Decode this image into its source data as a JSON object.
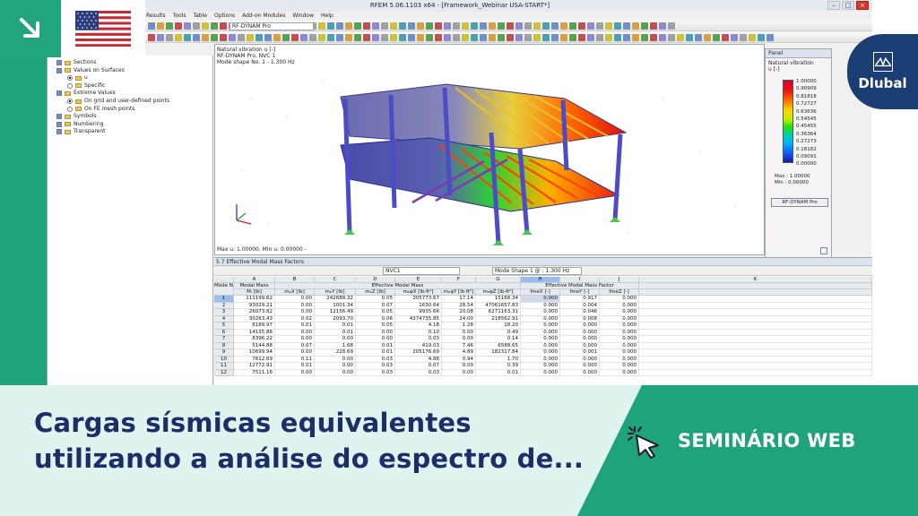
{
  "app": {
    "title": "RFEM 5.06.1103 x64 - [Framework_Webinar USA-START*]",
    "menu": [
      "Results",
      "Tools",
      "Table",
      "Options",
      "Add-on Modules",
      "Window",
      "Help"
    ],
    "module_combo": "RF-DYNAM Pro"
  },
  "navigator": {
    "items": [
      {
        "label": "Sections",
        "control": "check"
      },
      {
        "label": "Values on Surfaces",
        "control": "check"
      },
      {
        "label": "u",
        "control": "radio-on"
      },
      {
        "label": "Specific",
        "control": "radio"
      },
      {
        "label": "Extreme Values",
        "control": "check"
      },
      {
        "label": "On grid and user-defined points",
        "control": "radio-on"
      },
      {
        "label": "On FE mesh points",
        "control": "radio"
      },
      {
        "label": "Symbols",
        "control": "check"
      },
      {
        "label": "Numbering",
        "control": "check"
      },
      {
        "label": "Transparent",
        "control": "check"
      }
    ]
  },
  "viewport": {
    "info_line1": "Natural vibration u [-]",
    "info_line2": "RF-DYNAM Pro, NVC 1",
    "info_line3": "Mode shape No. 1 - 1.300 Hz",
    "status": "Max u: 1.00000, Min u: 0.00000 -"
  },
  "panel": {
    "title": "Panel",
    "subtitle": "Natural vibration",
    "unit": "u [-]",
    "scale": [
      "1.00000",
      "0.90909",
      "0.81818",
      "0.72727",
      "0.63636",
      "0.54545",
      "0.45455",
      "0.36364",
      "0.27273",
      "0.18182",
      "0.09091",
      "0.00000"
    ],
    "max_label": "Max : 1.00000",
    "min_label": "Min : 0.00000",
    "button": "RF-DYNAM Pro"
  },
  "table": {
    "title": "5.7 Effective Modal Mass Factors",
    "combo_nvc": "NVC1",
    "combo_mode": "Mode Shape 1 @ : 1.300 Hz",
    "col_letters": [
      "A",
      "B",
      "C",
      "D",
      "E",
      "F",
      "G",
      "H",
      "I",
      "J",
      "K"
    ],
    "group_headers": {
      "mode": "Mode No.",
      "modal_mass": "Modal Mass",
      "effective_modal_mass": "Effective Modal Mass",
      "effective_modal_mass_factor": "Effective Modal Mass Factor"
    },
    "sub_headers": [
      "Mᵢ [lb]",
      "mₑX [lb]",
      "mₑY [lb]",
      "mₑZ [lb]",
      "mₑφX [lb·ft²]",
      "mₑφY [lb·ft²]",
      "mₑφZ [lb·ft²]",
      "fmeX [-]",
      "fmeY [-]",
      "fmeZ [-]"
    ],
    "rows": [
      [
        "1",
        "111199.62",
        "0.00",
        "242688.32",
        "0.05",
        "305773.67",
        "17.14",
        "15168.34",
        "0.000",
        "0.917",
        "0.000"
      ],
      [
        "2",
        "93029.21",
        "0.00",
        "1001.34",
        "0.07",
        "1630.64",
        "28.54",
        "47061657.83",
        "0.000",
        "0.004",
        "0.000"
      ],
      [
        "3",
        "26073.82",
        "0.00",
        "12156.49",
        "0.05",
        "9935.66",
        "20.08",
        "6271163.31",
        "0.000",
        "0.046",
        "0.000"
      ],
      [
        "4",
        "30263.43",
        "0.02",
        "2093.70",
        "0.06",
        "4374735.85",
        "24.00",
        "218562.91",
        "0.000",
        "0.008",
        "0.000"
      ],
      [
        "5",
        "8189.97",
        "0.01",
        "0.01",
        "0.05",
        "4.18",
        "1.28",
        "18.20",
        "0.000",
        "0.000",
        "0.000"
      ],
      [
        "6",
        "14135.86",
        "0.00",
        "0.01",
        "0.00",
        "0.10",
        "0.00",
        "0.49",
        "0.000",
        "0.000",
        "0.000"
      ],
      [
        "7",
        "8396.22",
        "0.00",
        "0.00",
        "0.00",
        "0.03",
        "0.00",
        "0.14",
        "0.000",
        "0.000",
        "0.000"
      ],
      [
        "8",
        "5144.88",
        "0.07",
        "1.68",
        "0.01",
        "419.03",
        "7.46",
        "6588.65",
        "0.000",
        "0.000",
        "0.000"
      ],
      [
        "9",
        "10699.94",
        "0.00",
        "228.69",
        "0.01",
        "205176.69",
        "4.89",
        "182317.84",
        "0.000",
        "0.001",
        "0.000"
      ],
      [
        "10",
        "7612.69",
        "0.11",
        "0.00",
        "0.03",
        "4.88",
        "0.94",
        "1.70",
        "0.000",
        "0.000",
        "0.000"
      ],
      [
        "11",
        "12772.91",
        "0.01",
        "0.00",
        "0.03",
        "0.07",
        "0.00",
        "0.39",
        "0.000",
        "0.000",
        "0.000"
      ],
      [
        "12",
        "7511.16",
        "0.00",
        "0.00",
        "0.03",
        "0.03",
        "0.00",
        "0.01",
        "0.000",
        "0.000",
        "0.000"
      ]
    ]
  },
  "brand": {
    "logo_text": "Dlubal",
    "badge_color": "#1a3e74",
    "accent_green": "#1fa37c"
  },
  "banner": {
    "headline_line1": "Cargas sísmicas equivalentes",
    "headline_line2": "utilizando a análise do espectro de...",
    "cta": "SEMINÁRIO WEB",
    "cta_icon": "click-cursor-icon"
  }
}
